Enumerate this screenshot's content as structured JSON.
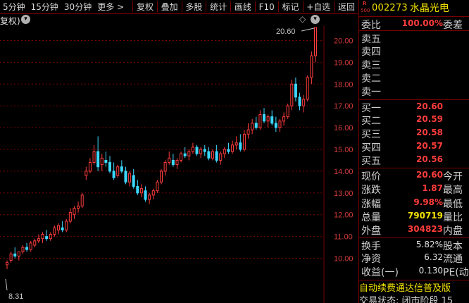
{
  "toolbar": {
    "periods": [
      "5分钟",
      "15分钟",
      "30分钟"
    ],
    "more": "更多 >",
    "actions": [
      "复权",
      "叠加",
      "多股",
      "统计",
      "画线",
      "F10",
      "标记",
      "+自选",
      "返回"
    ]
  },
  "subheader": {
    "fq_label": "复权)",
    "fq_icon": "chevron-down-icon",
    "diamond_icon": "◇"
  },
  "chart_data": {
    "type": "candlestick",
    "ylim": [
      9.6,
      20.9
    ],
    "yticks": [
      "20.00",
      "19.00",
      "18.00",
      "17.00",
      "16.00",
      "15.00",
      "14.00",
      "13.00",
      "12.00",
      "11.00",
      "10.00"
    ],
    "ytick_values": [
      20,
      19,
      18,
      17,
      16,
      15,
      14,
      13,
      12,
      11,
      10
    ],
    "high_label": "20.60",
    "low_label": "8.31",
    "up_color": "#ff3c3c",
    "down_color": "#3cd8ff",
    "grid_color": "#7a0000",
    "candles": [
      [
        9.7,
        9.9,
        9.5,
        9.8
      ],
      [
        9.9,
        10.3,
        9.8,
        10.2
      ],
      [
        10.2,
        10.5,
        10.0,
        10.1
      ],
      [
        10.1,
        10.3,
        9.9,
        10.3
      ],
      [
        10.3,
        10.6,
        10.2,
        10.5
      ],
      [
        10.5,
        10.7,
        10.3,
        10.4
      ],
      [
        10.4,
        10.8,
        10.3,
        10.7
      ],
      [
        10.6,
        10.9,
        10.5,
        10.8
      ],
      [
        10.8,
        11.1,
        10.7,
        10.9
      ],
      [
        10.9,
        11.2,
        10.7,
        11.1
      ],
      [
        11.0,
        11.3,
        10.8,
        10.9
      ],
      [
        10.9,
        11.2,
        10.8,
        11.1
      ],
      [
        11.1,
        11.5,
        11.0,
        11.4
      ],
      [
        11.3,
        11.6,
        11.1,
        11.5
      ],
      [
        11.4,
        11.7,
        11.2,
        11.3
      ],
      [
        11.3,
        11.8,
        11.2,
        11.7
      ],
      [
        11.7,
        12.3,
        11.6,
        12.1
      ],
      [
        12.0,
        12.4,
        11.8,
        12.3
      ],
      [
        12.3,
        12.6,
        12.1,
        12.4
      ],
      [
        12.4,
        13.0,
        12.3,
        12.9
      ],
      [
        13.8,
        14.2,
        13.6,
        14.0
      ],
      [
        14.0,
        14.6,
        13.9,
        14.4
      ],
      [
        14.4,
        15.2,
        14.3,
        14.9
      ],
      [
        14.9,
        15.6,
        14.0,
        14.2
      ],
      [
        14.3,
        14.8,
        14.0,
        14.6
      ],
      [
        14.5,
        14.9,
        14.2,
        14.4
      ],
      [
        14.4,
        14.7,
        13.9,
        14.0
      ],
      [
        14.0,
        14.4,
        13.6,
        13.7
      ],
      [
        13.8,
        14.3,
        13.7,
        14.2
      ],
      [
        14.2,
        14.5,
        13.9,
        14.0
      ],
      [
        14.0,
        14.2,
        13.4,
        13.5
      ],
      [
        13.5,
        14.0,
        13.3,
        13.9
      ],
      [
        13.8,
        14.1,
        13.2,
        13.3
      ],
      [
        13.3,
        13.6,
        12.9,
        13.0
      ],
      [
        13.0,
        13.4,
        12.8,
        13.2
      ],
      [
        13.1,
        13.3,
        12.6,
        12.7
      ],
      [
        12.7,
        13.0,
        12.5,
        12.9
      ],
      [
        12.9,
        13.2,
        12.7,
        13.1
      ],
      [
        13.1,
        13.6,
        13.0,
        13.5
      ],
      [
        13.5,
        14.1,
        13.4,
        14.0
      ],
      [
        14.0,
        14.5,
        13.8,
        14.4
      ],
      [
        14.4,
        14.9,
        14.3,
        14.6
      ],
      [
        14.5,
        14.8,
        14.2,
        14.3
      ],
      [
        14.3,
        14.6,
        14.1,
        14.5
      ],
      [
        14.5,
        14.9,
        14.4,
        14.8
      ],
      [
        14.8,
        15.1,
        14.6,
        14.7
      ],
      [
        14.7,
        15.0,
        14.5,
        14.9
      ],
      [
        14.9,
        15.3,
        14.8,
        15.1
      ],
      [
        15.1,
        15.2,
        14.7,
        14.8
      ],
      [
        14.8,
        15.1,
        14.6,
        15.0
      ],
      [
        15.0,
        15.2,
        14.7,
        14.9
      ],
      [
        14.9,
        15.1,
        14.5,
        14.6
      ],
      [
        14.6,
        15.0,
        14.5,
        14.9
      ],
      [
        14.9,
        15.2,
        14.4,
        14.5
      ],
      [
        14.5,
        14.9,
        14.3,
        14.8
      ],
      [
        14.8,
        15.1,
        14.6,
        15.0
      ],
      [
        15.0,
        15.3,
        14.8,
        14.9
      ],
      [
        14.9,
        15.4,
        14.8,
        15.2
      ],
      [
        15.2,
        15.6,
        15.0,
        15.3
      ],
      [
        15.3,
        15.7,
        14.9,
        15.0
      ],
      [
        15.0,
        15.9,
        14.9,
        15.7
      ],
      [
        15.7,
        16.2,
        15.5,
        15.9
      ],
      [
        15.9,
        16.4,
        15.7,
        16.2
      ],
      [
        16.2,
        16.5,
        15.9,
        16.0
      ],
      [
        16.0,
        16.8,
        15.9,
        16.6
      ],
      [
        16.6,
        16.9,
        16.2,
        16.3
      ],
      [
        16.3,
        16.6,
        16.0,
        16.5
      ],
      [
        16.5,
        16.8,
        16.1,
        16.2
      ],
      [
        16.2,
        16.5,
        15.8,
        16.0
      ],
      [
        16.0,
        16.4,
        15.8,
        16.3
      ],
      [
        16.3,
        16.7,
        16.1,
        16.5
      ],
      [
        16.5,
        17.1,
        16.4,
        17.0
      ],
      [
        17.0,
        18.2,
        16.8,
        18.0
      ],
      [
        18.0,
        18.3,
        17.2,
        17.4
      ],
      [
        17.4,
        17.6,
        16.8,
        17.0
      ],
      [
        17.0,
        17.5,
        16.7,
        17.3
      ],
      [
        17.3,
        18.4,
        17.2,
        18.3
      ],
      [
        18.3,
        19.5,
        18.0,
        19.3
      ],
      [
        19.3,
        20.6,
        19.0,
        20.6
      ]
    ]
  },
  "quote": {
    "logo_r": "R",
    "logo_num": "500",
    "code": "002273",
    "name": "水晶光电",
    "ratio_label": "委比",
    "ratio_value": "100.00%",
    "ratio_right": "委差",
    "sell": [
      {
        "label": "卖五",
        "price": ""
      },
      {
        "label": "卖四",
        "price": ""
      },
      {
        "label": "卖三",
        "price": ""
      },
      {
        "label": "卖二",
        "price": ""
      },
      {
        "label": "卖一",
        "price": ""
      }
    ],
    "buy": [
      {
        "label": "买一",
        "price": "20.60"
      },
      {
        "label": "买二",
        "price": "20.59"
      },
      {
        "label": "买三",
        "price": "20.58"
      },
      {
        "label": "买四",
        "price": "20.57"
      },
      {
        "label": "买五",
        "price": "20.56"
      }
    ],
    "stats": [
      {
        "label": "现价",
        "value": "20.60",
        "right": "今开"
      },
      {
        "label": "涨跌",
        "value": "1.87",
        "right": "最高"
      },
      {
        "label": "涨幅",
        "value": "9.98%",
        "right": "最低"
      },
      {
        "label": "总量",
        "value": "790719",
        "right": "量比"
      },
      {
        "label": "外盘",
        "value": "304823",
        "right": "内盘"
      }
    ],
    "fund": [
      {
        "label": "换手",
        "value": "5.82%",
        "right": "股本"
      },
      {
        "label": "净资",
        "value": "6.32",
        "right": "流通"
      },
      {
        "label": "收益(一)",
        "value": "0.130",
        "right": "PE(动"
      }
    ],
    "banner": "自动续费通达信普及版",
    "status": "交易状态: 闭市阶段 15"
  }
}
